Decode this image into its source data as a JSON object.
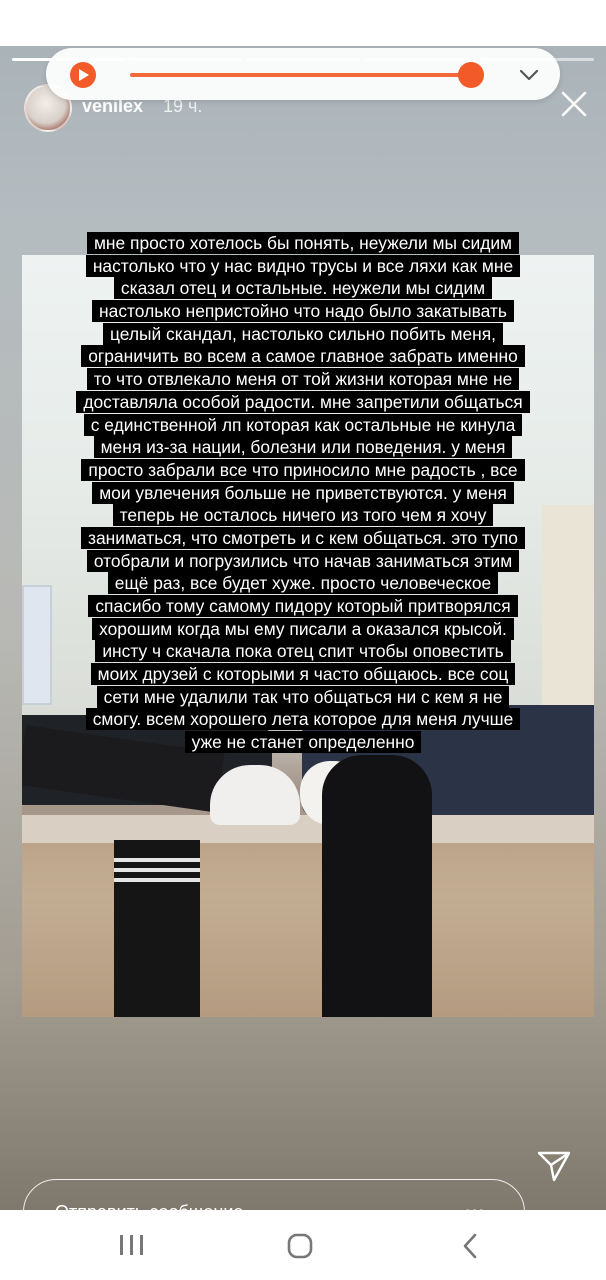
{
  "story": {
    "username": "venilex",
    "time_ago": "19 ч.",
    "progress_segments": [
      true,
      false,
      false,
      false,
      false
    ],
    "text_lines": [
      "мне просто хотелось бы понять, неужели мы сидим",
      "настолько что у нас видно трусы и все ляхи как мне",
      "сказал отец и остальные. неужели мы сидим",
      "настолько непристойно что надо было закатывать",
      "целый скандал, настолько сильно побить меня,",
      "ограничить во всем а самое главное забрать именно",
      "то что отвлекало меня от той жизни которая мне не",
      "доставляла особой радости. мне запретили общаться",
      "с единственной лп которая как остальные не кинула",
      "меня из-за нации, болезни или поведения. у меня",
      "просто забрали все что приносило мне радость , все",
      "мои увлечения больше не приветствуются. у меня",
      "теперь не осталось ничего из того чем я хочу",
      "заниматься, что смотреть и с кем общаться. это тупо",
      "отобрали и погрузились что начав заниматься этим",
      "ещё раз, все будет хуже. просто человеческое",
      "спасибо тому самому пидору который притворялся",
      "хорошим когда мы ему писали а оказался крысой.",
      "инсту ч скачала пока отец спит чтобы оповестить",
      "моих друзей с которыми я часто общаюсь. все соц",
      "сети мне удалили так что общаться ни с кем я не",
      "смогу. всем хорошего лета которое для меня лучше",
      "уже не станет определенно"
    ]
  },
  "audio_player": {
    "progress_fraction": 0.97,
    "accent_color": "#f35a2a",
    "play_icon": "play-icon",
    "collapse_icon": "chevron-down-icon"
  },
  "reply_bar": {
    "placeholder": "Отправить сообщение",
    "more_glyph": "•••",
    "send_icon": "send-icon"
  },
  "system_nav": {
    "recent_icon": "recent-apps-icon",
    "home_icon": "home-icon",
    "back_icon": "back-icon"
  }
}
